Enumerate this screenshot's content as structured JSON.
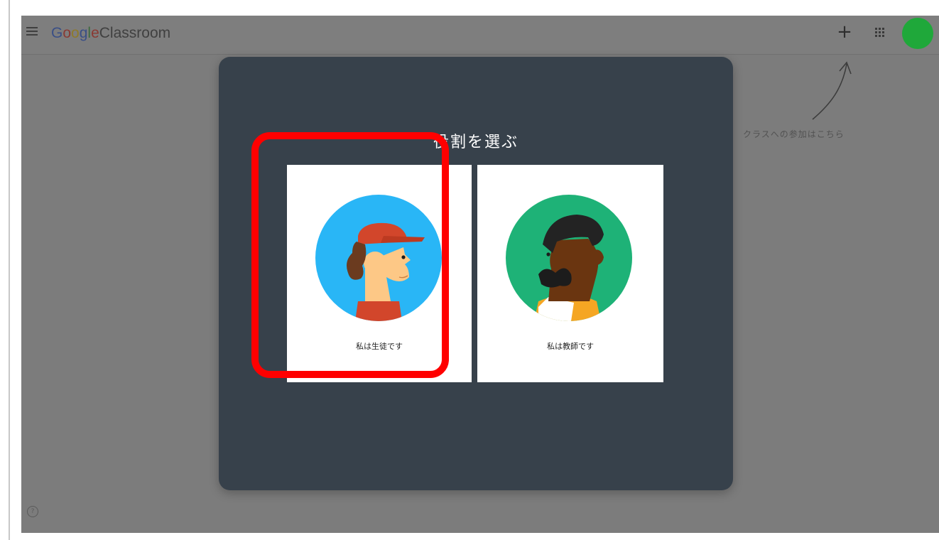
{
  "app": {
    "brand_letters": [
      "G",
      "o",
      "o",
      "g",
      "l",
      "e"
    ],
    "product": "Classroom"
  },
  "header": {
    "add_icon": "plus-icon",
    "apps_icon": "apps-grid-icon",
    "avatar_color": "#1fa83a"
  },
  "annotation": {
    "hint": "クラスへの参加はこちら"
  },
  "dialog": {
    "title": "役割を選ぶ",
    "roles": [
      {
        "label": "私は生徒です",
        "icon": "student-avatar-icon",
        "circle_color": "#29b6f6",
        "selected": true
      },
      {
        "label": "私は教師です",
        "icon": "teacher-avatar-icon",
        "circle_color": "#1eb277",
        "selected": false
      }
    ]
  },
  "colors": {
    "dialog_bg": "#37414b",
    "highlight": "#ff0000",
    "overlay": "#7c7c7c"
  }
}
